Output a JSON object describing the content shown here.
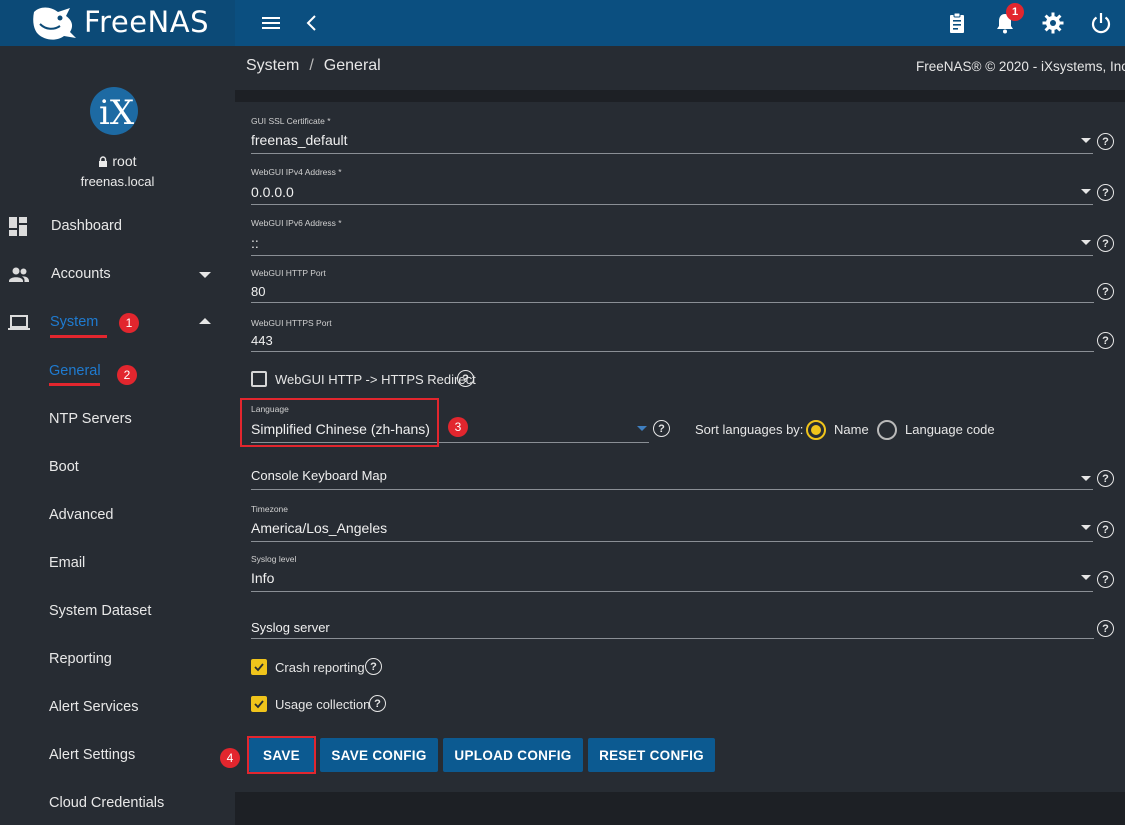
{
  "app": {
    "name": "FreeNAS",
    "notification_count": "1",
    "colors": {
      "topbar": "#0b4f80",
      "sidebar": "#272c33",
      "accent_red": "#e2262e",
      "accent_yellow": "#f0c41b",
      "button": "#0c5a91"
    }
  },
  "topbar": {
    "icons": [
      "menu-icon",
      "chevron-left-icon",
      "clipboard-icon",
      "bell-icon",
      "gear-icon",
      "power-icon"
    ]
  },
  "user": {
    "name": "root",
    "host": "freenas.local"
  },
  "sidebar": {
    "items": [
      {
        "label": "Dashboard",
        "icon": "dashboard-icon"
      },
      {
        "label": "Accounts",
        "icon": "accounts-icon"
      },
      {
        "label": "System",
        "icon": "laptop-icon"
      }
    ],
    "system_sub": [
      "General",
      "NTP Servers",
      "Boot",
      "Advanced",
      "Email",
      "System Dataset",
      "Reporting",
      "Alert Services",
      "Alert Settings",
      "Cloud Credentials"
    ],
    "markers": [
      "1",
      "2"
    ]
  },
  "breadcrumb": {
    "parent": "System",
    "current": "General"
  },
  "copyright": "FreeNAS® © 2020 - iXsystems, Inc",
  "form": {
    "ssl_cert": {
      "label": "GUI SSL Certificate *",
      "value": "freenas_default"
    },
    "ipv4": {
      "label": "WebGUI IPv4 Address *",
      "value": "0.0.0.0"
    },
    "ipv6": {
      "label": "WebGUI IPv6 Address *",
      "value": "::"
    },
    "http_port": {
      "label": "WebGUI HTTP Port",
      "value": "80"
    },
    "https_port": {
      "label": "WebGUI HTTPS Port",
      "value": "443"
    },
    "redirect": {
      "label": "WebGUI HTTP -> HTTPS Redirect",
      "checked": false
    },
    "language": {
      "label": "Language",
      "value": "Simplified Chinese (zh-hans)",
      "marker": "3"
    },
    "sort_by": {
      "label": "Sort languages by:",
      "options": [
        "Name",
        "Language code"
      ],
      "selected": "Name"
    },
    "keyboard": {
      "placeholder": "Console Keyboard Map"
    },
    "timezone": {
      "label": "Timezone",
      "value": "America/Los_Angeles"
    },
    "syslog_level": {
      "label": "Syslog level",
      "value": "Info"
    },
    "syslog_server": {
      "placeholder": "Syslog server"
    },
    "crash_reporting": {
      "label": "Crash reporting",
      "checked": true
    },
    "usage_collection": {
      "label": "Usage collection",
      "checked": true
    }
  },
  "buttons": {
    "save": "SAVE",
    "save_config": "SAVE CONFIG",
    "upload_config": "UPLOAD CONFIG",
    "reset_config": "RESET CONFIG",
    "save_marker": "4"
  }
}
